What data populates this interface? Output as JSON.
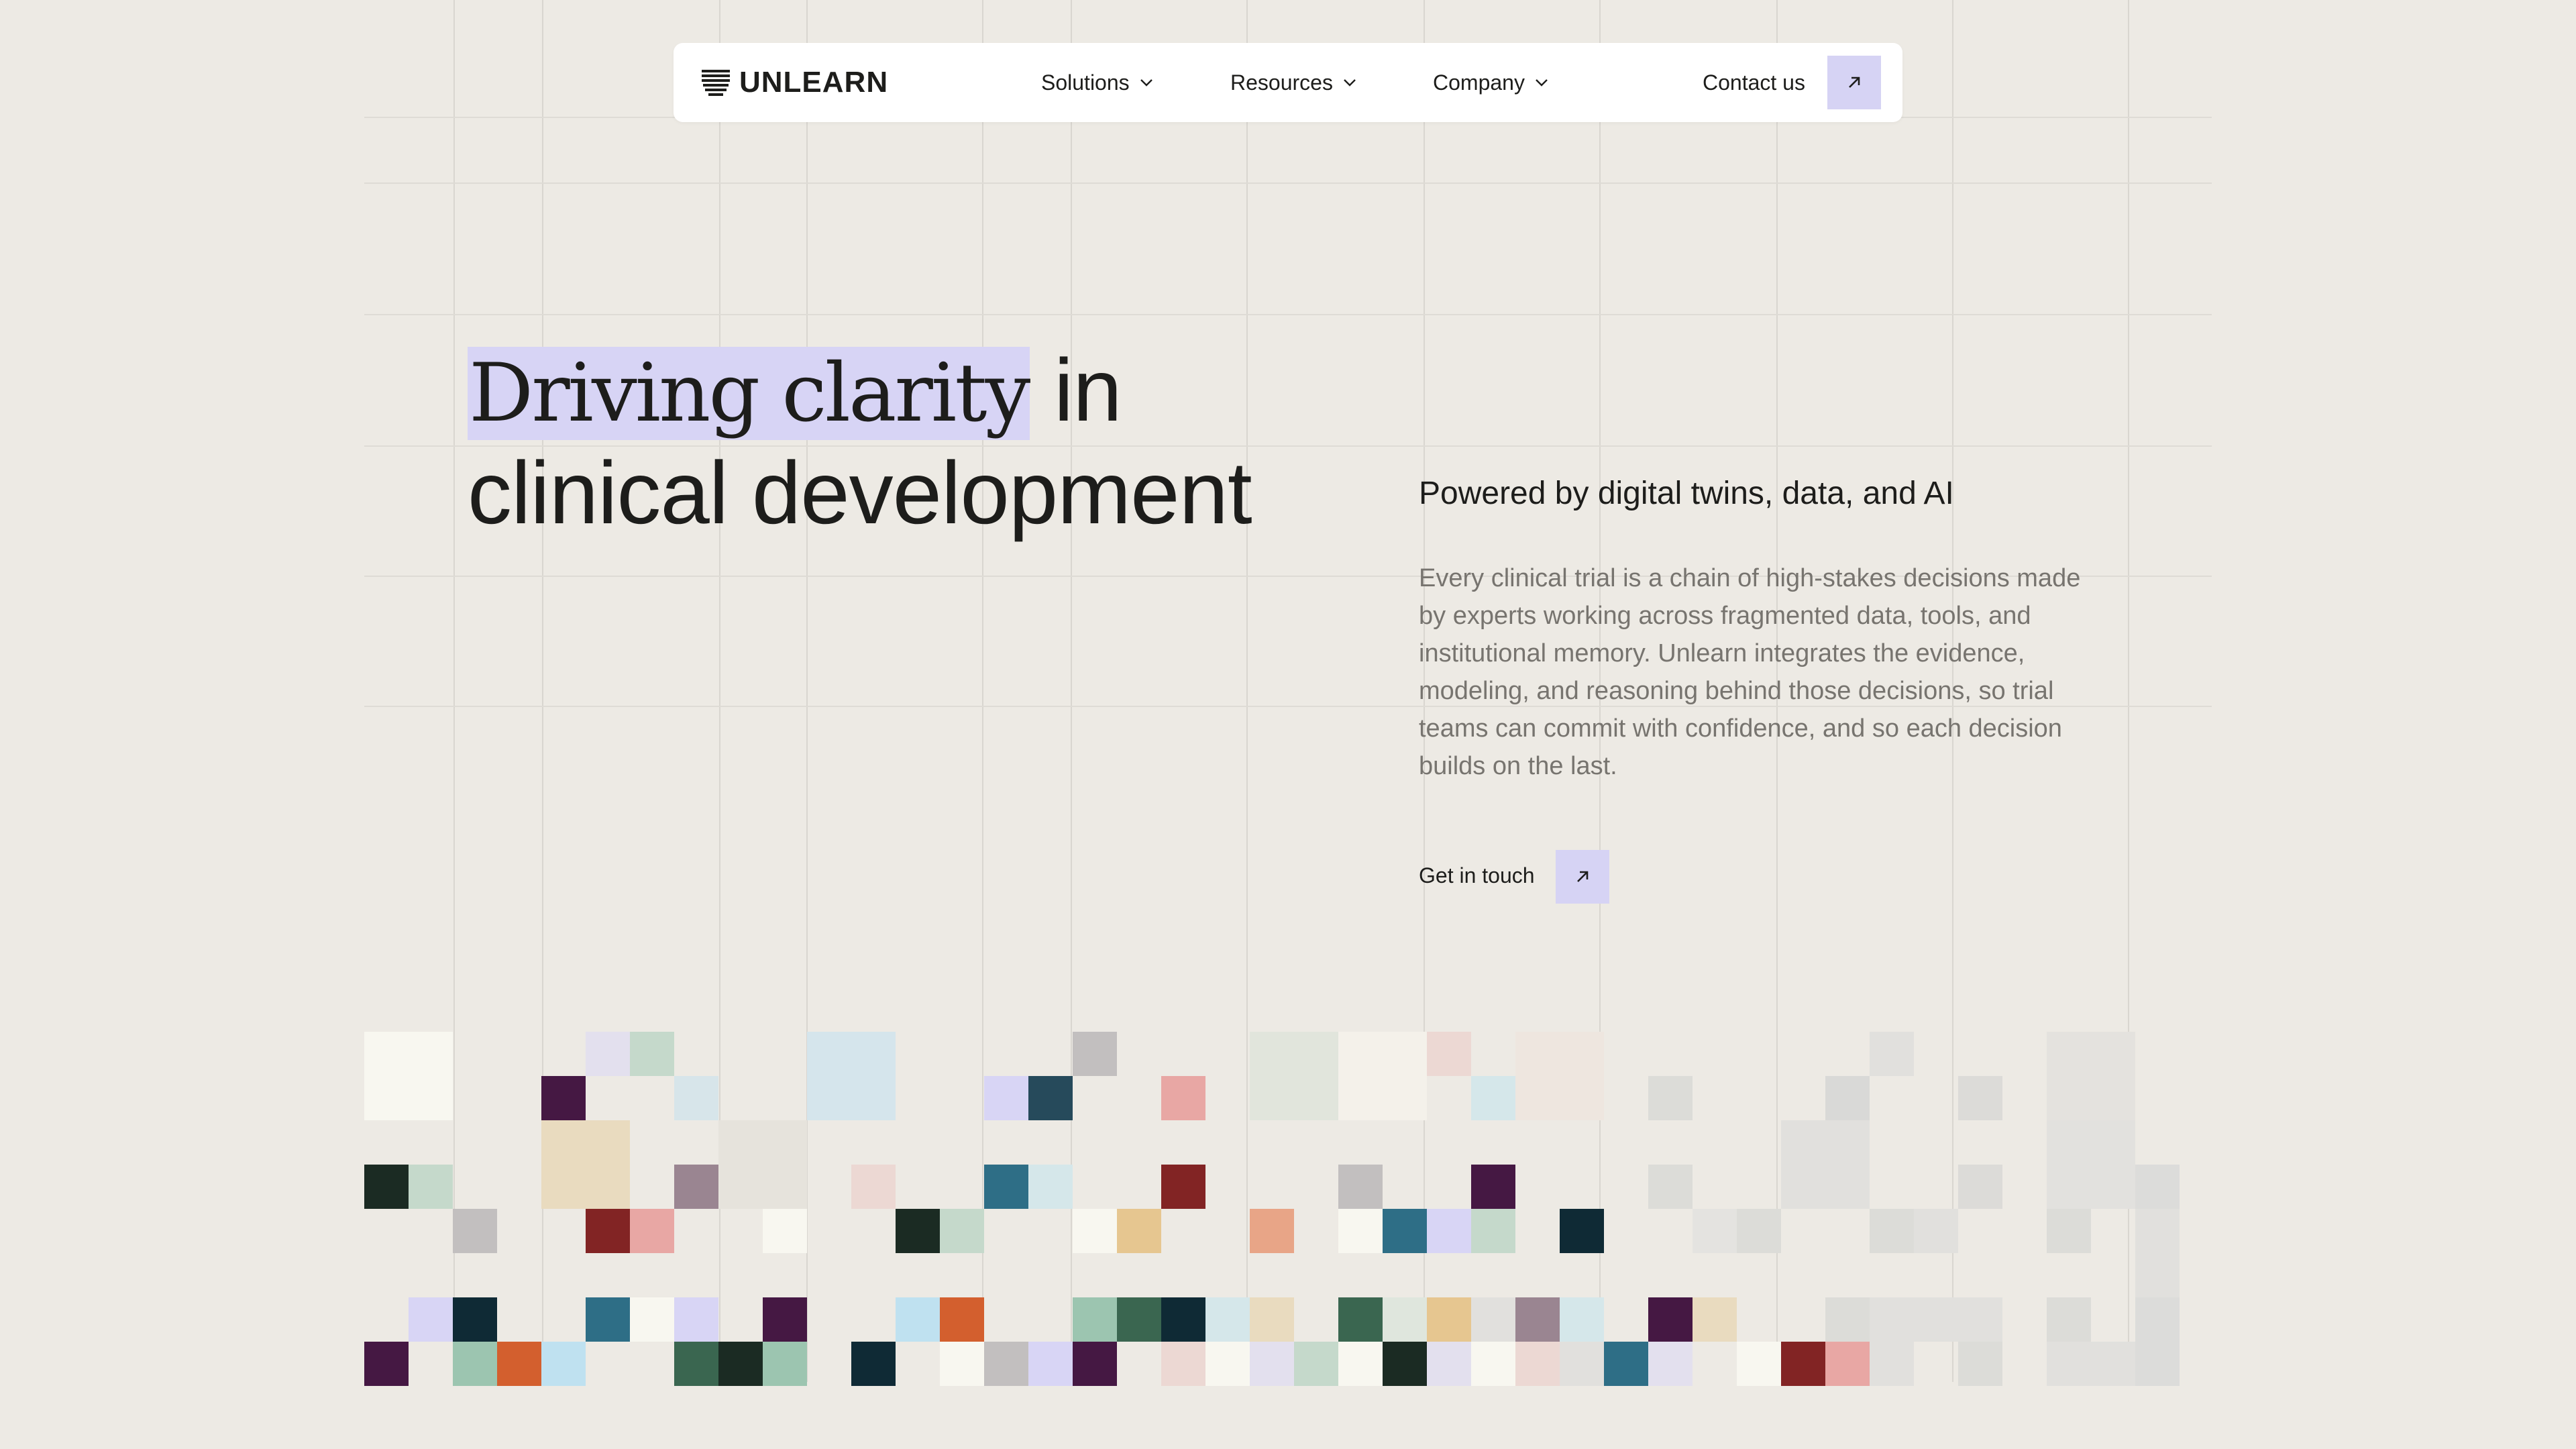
{
  "nav": {
    "brand": "UNLEARN",
    "items": [
      {
        "label": "Solutions"
      },
      {
        "label": "Resources"
      },
      {
        "label": "Company"
      }
    ],
    "contact_label": "Contact us"
  },
  "hero": {
    "title_highlight": "Driving clarity",
    "title_rest_line1": " in",
    "title_line2": "clinical development",
    "subtitle": "Powered by digital twins, data, and AI",
    "body": "Every clinical trial is a chain of high-stakes decisions made by experts working across fragmented data, tools, and institutional memory. Unlearn integrates the evidence, modeling, and reasoning behind those decisions, so trial teams can commit with confidence, and so each decision builds on the last.",
    "cta_label": "Get in touch"
  },
  "colors": {
    "background": "#edeae4",
    "accent": "#d7d4f5",
    "text": "#1d1d1b",
    "muted_text": "#77746f"
  },
  "icons": {
    "logo": "unlearn-logo-icon",
    "chevron": "chevron-down-icon",
    "arrow": "arrow-up-right-icon"
  }
}
